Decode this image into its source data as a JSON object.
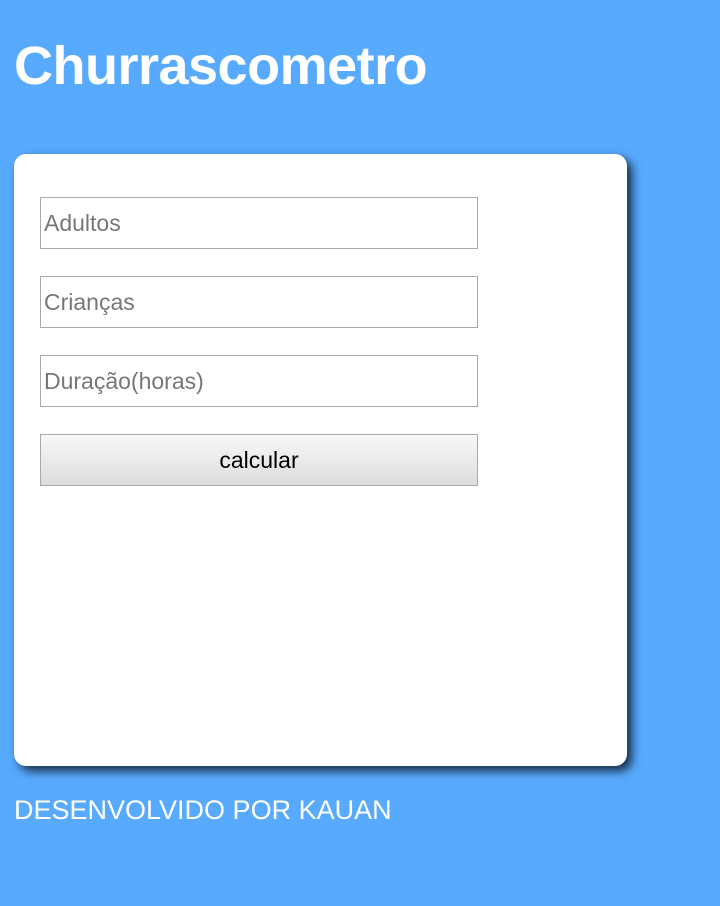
{
  "header": {
    "title": "Churrascometro"
  },
  "form": {
    "adultos_placeholder": "Adultos",
    "criancas_placeholder": "Crianças",
    "duracao_placeholder": "Duração(horas)",
    "calcular_label": "calcular"
  },
  "footer": {
    "text": "DESENVOLVIDO POR KAUAN"
  },
  "colors": {
    "background": "#58aaff",
    "card": "#ffffff",
    "title_text": "#ffffff"
  }
}
